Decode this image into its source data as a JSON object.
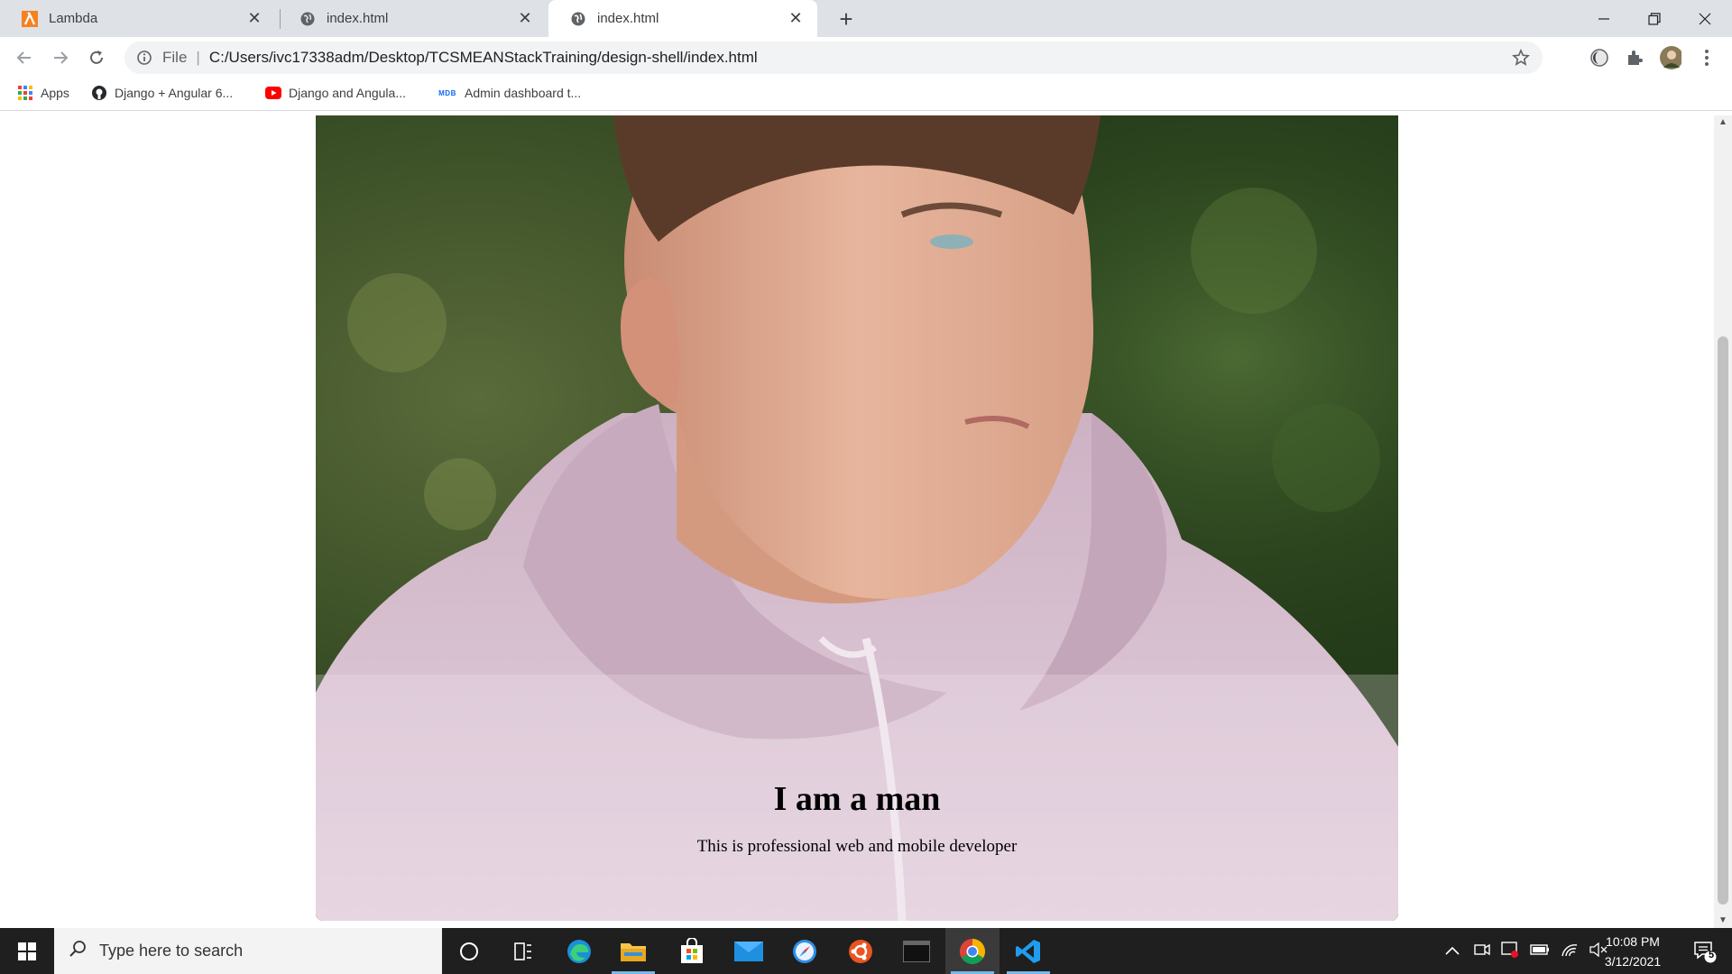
{
  "browser": {
    "tabs": [
      {
        "title": "Lambda",
        "icon": "lambda-favicon-icon",
        "active": false
      },
      {
        "title": "index.html",
        "icon": "globe-icon",
        "active": false
      },
      {
        "title": "index.html",
        "icon": "globe-icon",
        "active": true
      }
    ],
    "scheme_label": "File",
    "url": "C:/Users/ivc17338adm/Desktop/TCSMEANStackTraining/design-shell/index.html",
    "bookmarks": [
      {
        "label": "Apps",
        "icon": "apps-grid-icon"
      },
      {
        "label": "Django + Angular 6...",
        "icon": "github-icon"
      },
      {
        "label": "Django and Angula...",
        "icon": "youtube-icon"
      },
      {
        "label": "Admin dashboard t...",
        "icon": "mdb-icon",
        "badge": "MDB"
      }
    ]
  },
  "page": {
    "heading": "I am a man",
    "subtitle": "This is professional web and mobile developer"
  },
  "taskbar": {
    "search_placeholder": "Type here to search",
    "apps": [
      "cortana-icon",
      "task-view-icon",
      "edge-icon",
      "file-explorer-icon",
      "store-icon",
      "mail-icon",
      "safari-icon",
      "ubuntu-icon",
      "terminal-icon",
      "chrome-icon",
      "vscode-icon"
    ],
    "time": "10:08 PM",
    "date": "3/12/2021",
    "notification_count": "5"
  },
  "colors": {
    "accent": "#1a73e8",
    "taskbar": "#1f1f1f",
    "hoodie": "#d8c3d3"
  }
}
